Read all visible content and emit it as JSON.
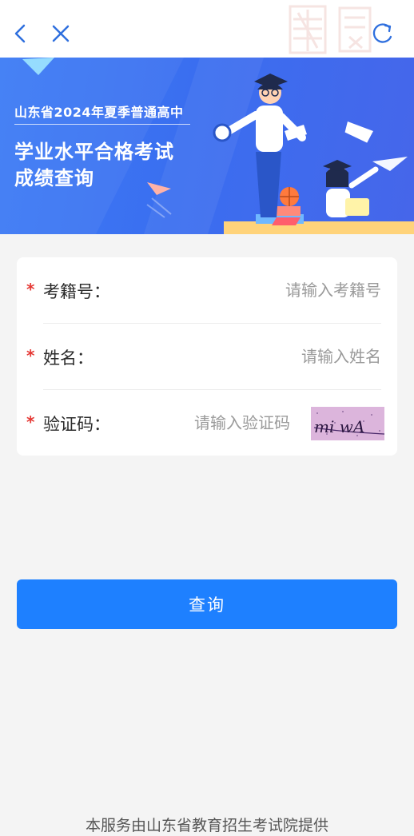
{
  "banner": {
    "subtitle": "山东省2024年夏季普通高中",
    "title_line1": "学业水平合格考试",
    "title_line2": "成绩查询"
  },
  "form": {
    "exam_id": {
      "label": "考籍号：",
      "placeholder": "请输入考籍号"
    },
    "name": {
      "label": "姓名：",
      "placeholder": "请输入姓名"
    },
    "captcha": {
      "label": "验证码：",
      "placeholder": "请输入验证码",
      "image_text": "mi wA"
    },
    "required_mark": "*"
  },
  "submit_label": "查询",
  "footer_text": "本服务由山东省教育招生考试院提供",
  "colors": {
    "primary": "#1e80ff",
    "banner": "#3d7cf5",
    "required": "#e53935",
    "background": "#f4f4f4"
  },
  "icons": [
    "back-icon",
    "close-icon",
    "refresh-icon"
  ]
}
